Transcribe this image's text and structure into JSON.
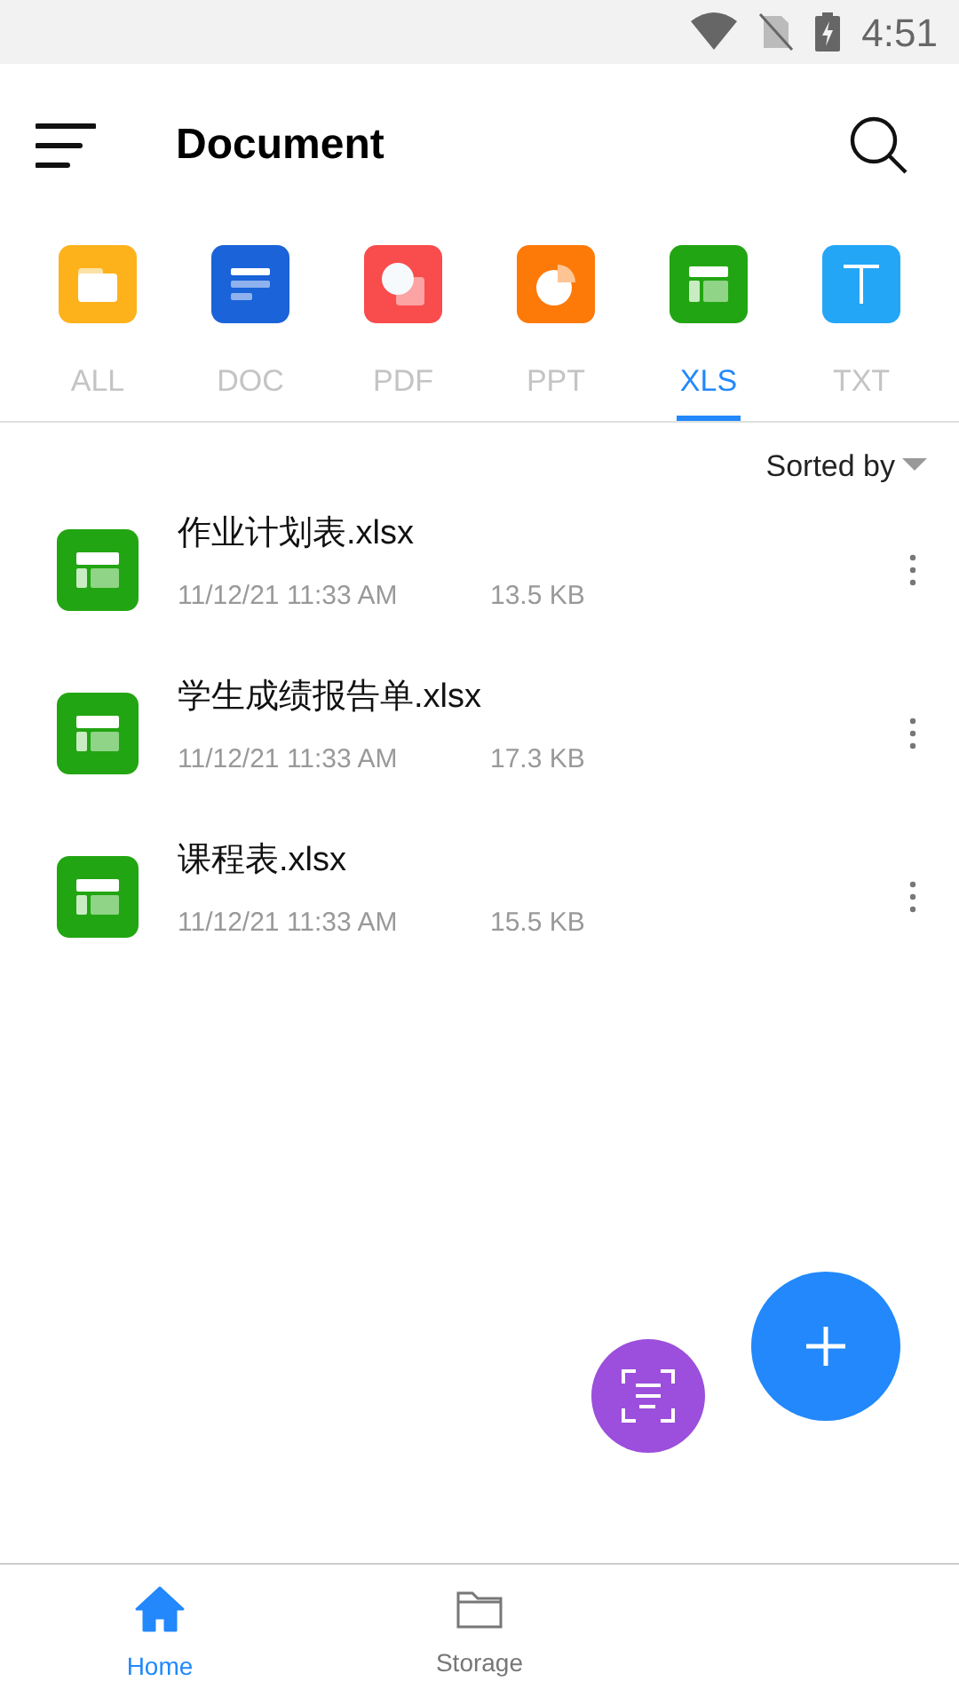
{
  "status_bar": {
    "time": "4:51"
  },
  "header": {
    "title": "Document"
  },
  "categories": [
    {
      "label": "ALL",
      "kind": "all",
      "selected": false
    },
    {
      "label": "DOC",
      "kind": "doc",
      "selected": false
    },
    {
      "label": "PDF",
      "kind": "pdf",
      "selected": false
    },
    {
      "label": "PPT",
      "kind": "ppt",
      "selected": false
    },
    {
      "label": "XLS",
      "kind": "xls",
      "selected": true
    },
    {
      "label": "TXT",
      "kind": "txt",
      "selected": false
    }
  ],
  "sort": {
    "label": "Sorted by"
  },
  "files": [
    {
      "name": "作业计划表.xlsx",
      "date": "11/12/21 11:33 AM",
      "size": "13.5 KB"
    },
    {
      "name": "学生成绩报告单.xlsx",
      "date": "11/12/21 11:33 AM",
      "size": "17.3 KB"
    },
    {
      "name": "课程表.xlsx",
      "date": "11/12/21 11:33 AM",
      "size": "15.5 KB"
    }
  ],
  "bottom_nav": [
    {
      "label": "Home",
      "kind": "home",
      "selected": true
    },
    {
      "label": "Storage",
      "kind": "storage",
      "selected": false
    }
  ]
}
